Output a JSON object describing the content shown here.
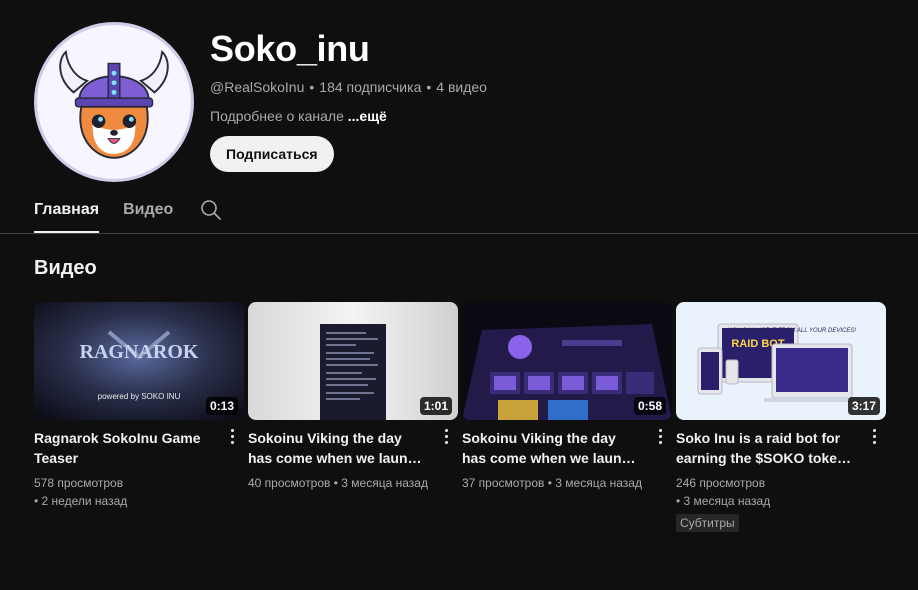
{
  "channel": {
    "name": "Soko_inu",
    "handle": "@RealSokoInu",
    "subscribers": "184 подписчика",
    "video_count": "4 видео",
    "separator": "•",
    "about": "Подробнее о канале",
    "about_more": "...ещё",
    "subscribe_label": "Подписаться"
  },
  "tabs": [
    {
      "label": "Главная",
      "active": true
    },
    {
      "label": "Видео",
      "active": false
    }
  ],
  "section": {
    "title": "Видео"
  },
  "videos": [
    {
      "title": "Ragnarok SokoInu Game Teaser",
      "duration": "0:13",
      "views": "578 просмотров",
      "age": "• 2 недели назад",
      "thumb_text": "RAGNAROK",
      "thumb_caption": "powered by SOKO INU"
    },
    {
      "title": "Sokoinu Viking the day has come when we launch our…",
      "duration": "1:01",
      "views": "40 просмотров",
      "age": "• 3 месяца назад"
    },
    {
      "title": "Sokoinu Viking the day has come when we launch our…",
      "duration": "0:58",
      "views": "37 просмотров",
      "age": "• 3 месяца назад"
    },
    {
      "title": "Soko Inu is a raid bot for earning the $SOKO token in …",
      "duration": "3:17",
      "views": "246 просмотров",
      "age": "• 3 месяца назад",
      "badge": "Субтитры",
      "thumb_text": "RAID BOT",
      "thumb_caption": "YOU CAN USE IT FROM ALL YOUR DEVICES!"
    }
  ],
  "colors": {
    "background": "#0f0f0f",
    "text": "#f1f1f1",
    "muted": "#aaaaaa",
    "divider": "#3f3f3f"
  }
}
